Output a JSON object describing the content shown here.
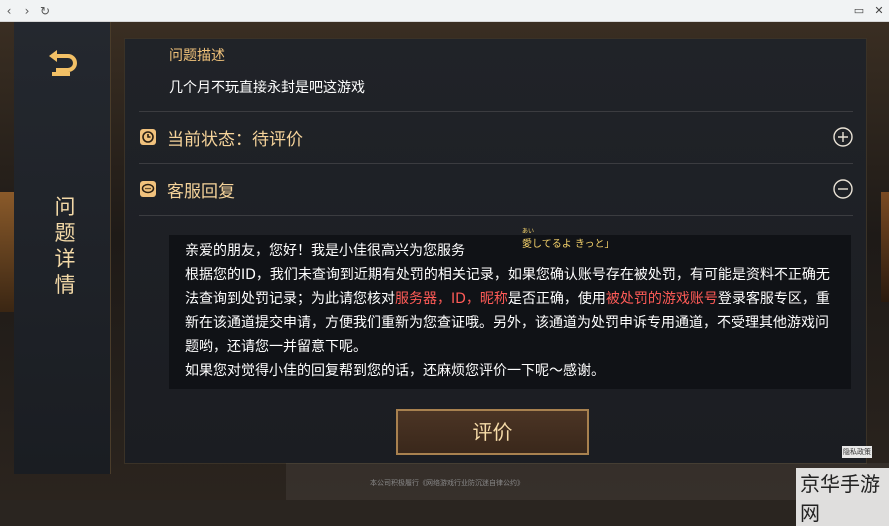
{
  "panel": {
    "side_title_chars": [
      "问",
      "题",
      "详",
      "情"
    ]
  },
  "question": {
    "label": "问题描述",
    "text": "几个月不玩直接永封是吧这游戏"
  },
  "status": {
    "label": "当前状态：待评价"
  },
  "reply": {
    "label": "客服回复",
    "p1": "亲爱的朋友，您好！我是小佳很高兴为您服务",
    "p2_a": "根据您的ID，我们未查询到近期有处罚的相关记录，如果您确认账号存在被处罚，有可能是资料不正确无法查询到处罚记录；为此请您核对",
    "p2_hl1": "服务器，ID，昵称",
    "p2_b": "是否正确，使用",
    "p2_hl2": "被处罚的游戏账号",
    "p2_c": "登录客服专区，重新在该通道提交申请，方便我们重新为您查证哦。另外，该通道为处罚申诉专用通道，不受理其他游戏问题哟，还请您一并留意下呢。",
    "p3": "如果您对觉得小佳的回复帮到您的话，还麻烦您评价一下呢～感谢。"
  },
  "rate_button": "评价",
  "sticker": {
    "ruby": "あい",
    "text": "愛してるよ きっと」"
  },
  "footer": "本公司积极履行《网络游戏行业防沉迷自律公约》",
  "brand": "京华手游网",
  "small_tag": "隐私政策",
  "colors": {
    "accent": "#f5d39a",
    "highlight": "#ff5b57",
    "button_border": "#a8814f"
  }
}
